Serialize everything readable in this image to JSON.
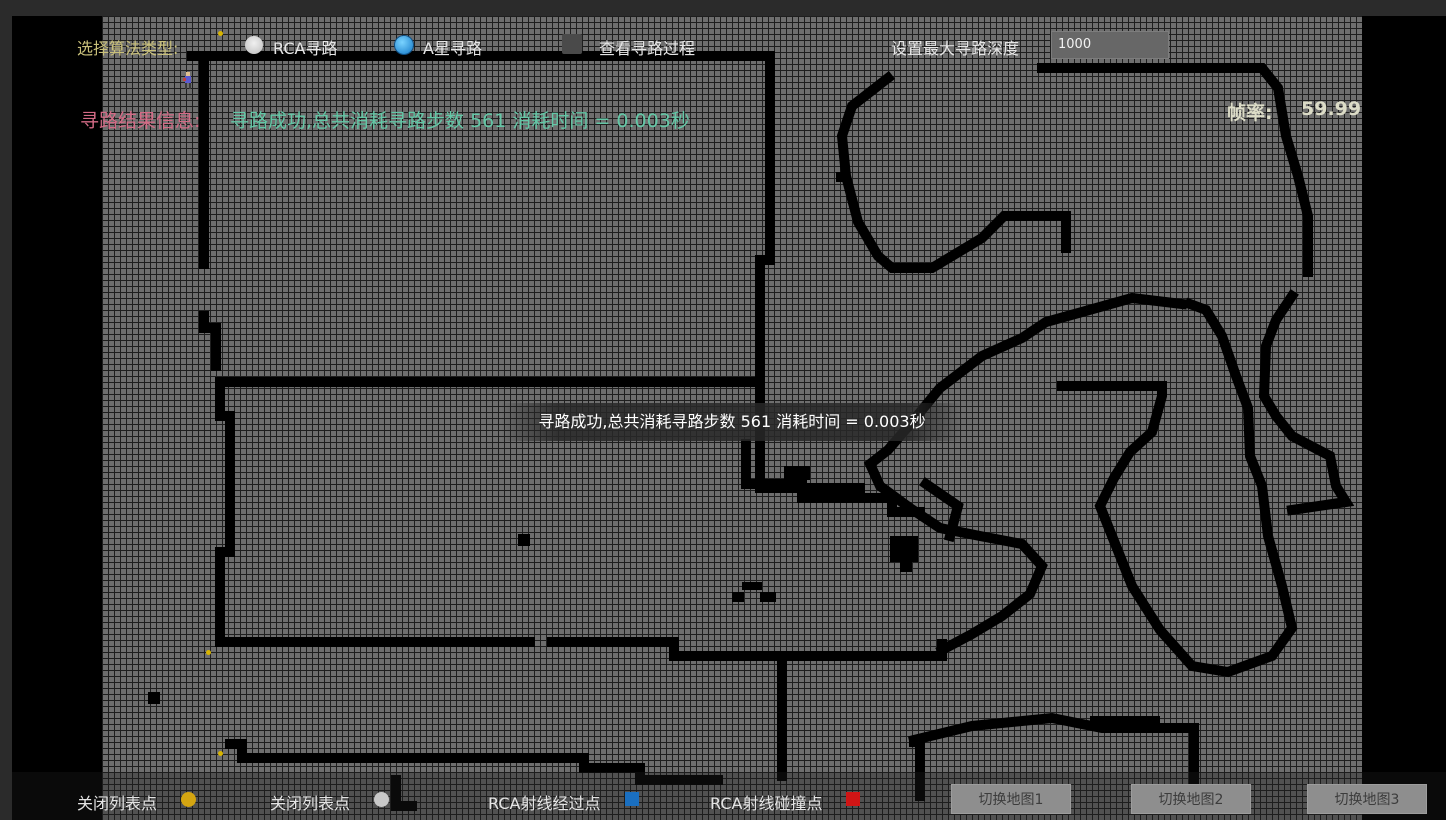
{
  "controls": {
    "algorithm_label": "选择算法类型:",
    "rca_label": "RCA寻路",
    "astar_label": "A星寻路",
    "view_process_label": "查看寻路过程",
    "max_depth_label": "设置最大寻路深度",
    "max_depth_value": "1000",
    "selected_algorithm": "A星寻路"
  },
  "result": {
    "label": "寻路结果信息:",
    "text": "寻路成功,总共消耗寻路步数 561 消耗时间 = 0.003秒"
  },
  "fps": {
    "label": "帧率:",
    "value": "59.99"
  },
  "toast": {
    "text": "寻路成功,总共消耗寻路步数 561 消耗时间 = 0.003秒"
  },
  "legend": {
    "items": [
      {
        "label": "关闭列表点",
        "color": "#d4a511"
      },
      {
        "label": "关闭列表点",
        "color": "#c8c8c8"
      },
      {
        "label": "RCA射线经过点",
        "color": "#1a6fc0"
      },
      {
        "label": "RCA射线碰撞点",
        "color": "#d01515"
      }
    ]
  },
  "buttons": {
    "map1": "切换地图1",
    "map2": "切换地图2",
    "map3": "切换地图3"
  },
  "colors": {
    "map_floor": "#6e6e6e",
    "wall": "#000000",
    "grid_line": "#1e1e1e",
    "result_label": "#d36b86",
    "result_value": "#63c7a6",
    "algorithm_label": "#c9c07a"
  }
}
